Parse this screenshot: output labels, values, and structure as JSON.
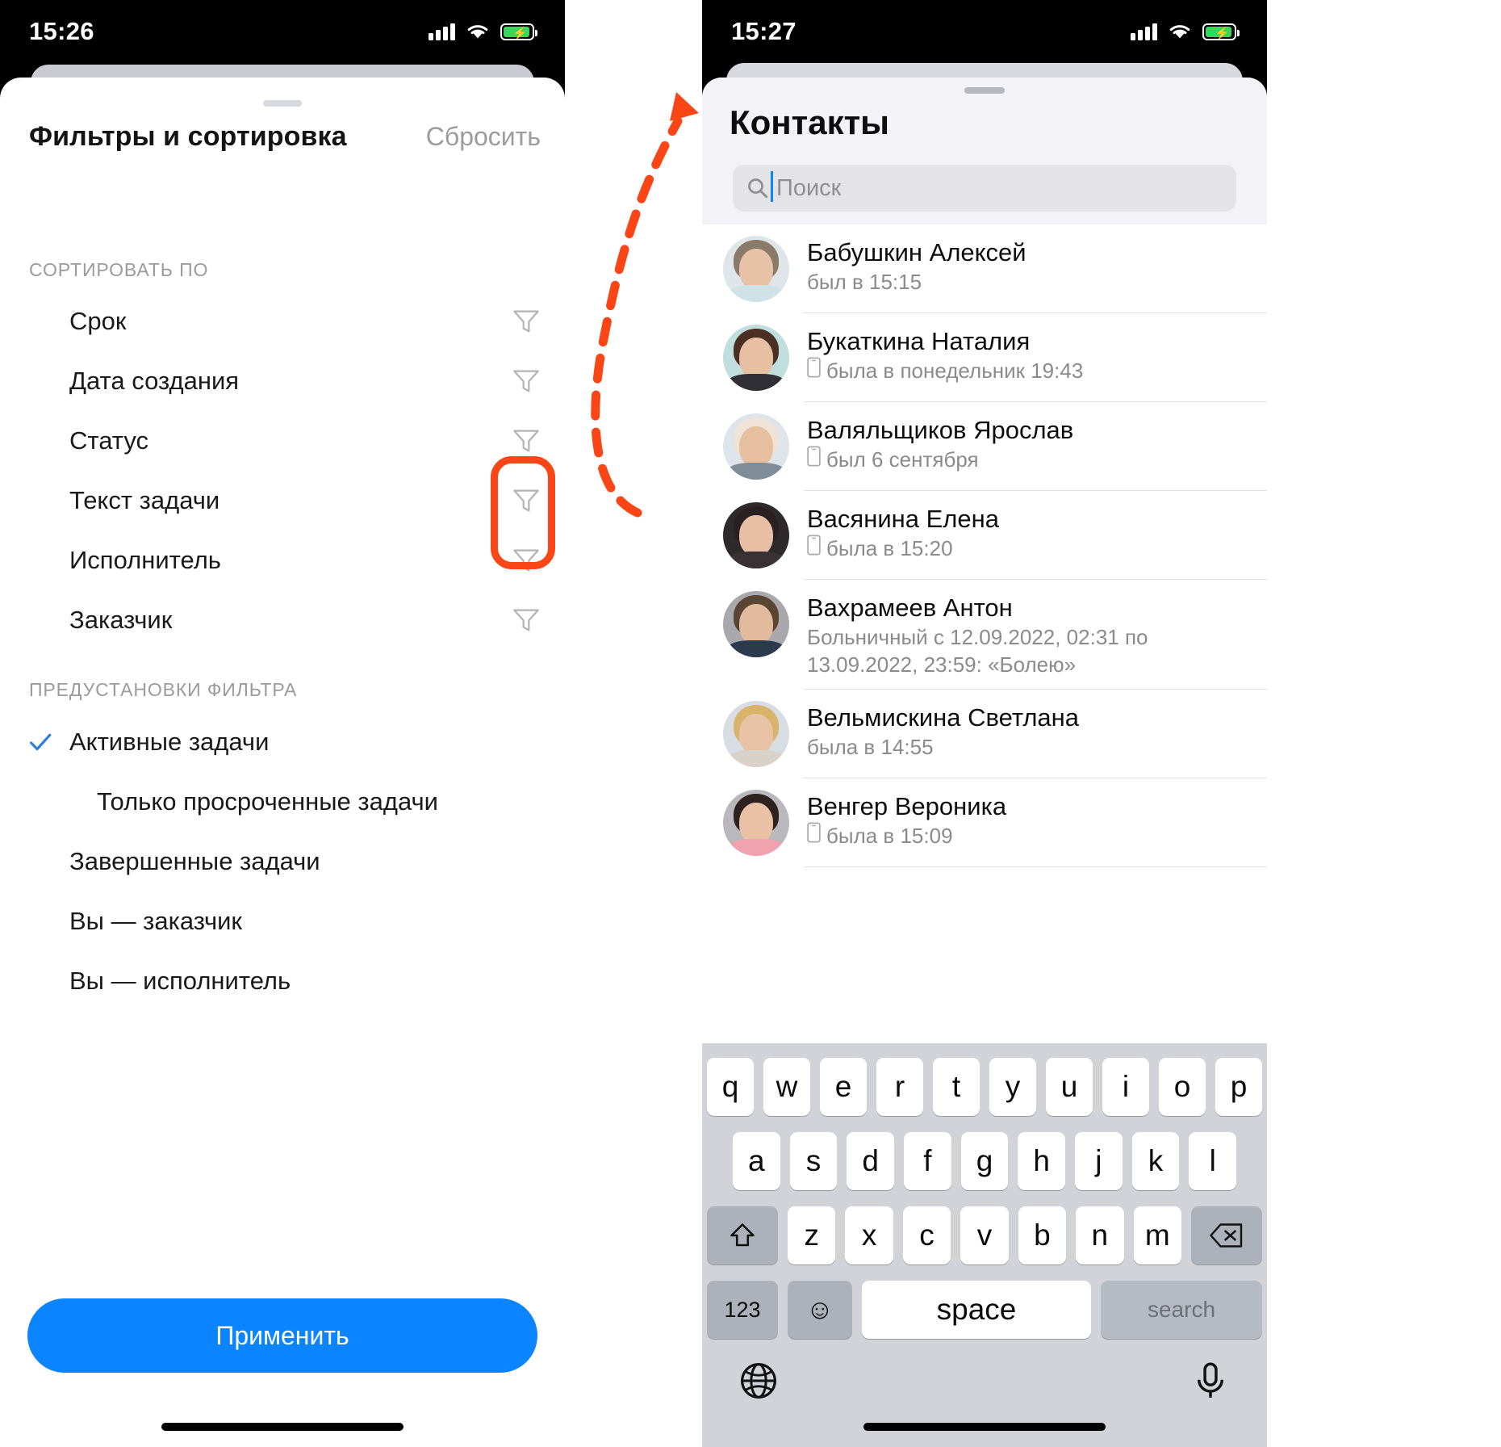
{
  "left_phone": {
    "status_bar": {
      "time": "15:26",
      "signal_icon": "cellular-bars-icon",
      "wifi_icon": "wifi-icon",
      "battery_icon": "battery-charging-icon"
    },
    "sheet": {
      "title": "Фильтры и сортировка",
      "reset_label": "Сбросить",
      "sort_section_label": "СОРТИРОВАТЬ ПО",
      "sort_rows": [
        {
          "label": "Срок",
          "filter_icon": "funnel-icon"
        },
        {
          "label": "Дата создания",
          "filter_icon": "funnel-icon"
        },
        {
          "label": "Статус",
          "filter_icon": "funnel-icon"
        },
        {
          "label": "Текст задачи",
          "filter_icon": "funnel-icon"
        },
        {
          "label": "Исполнитель",
          "filter_icon": "funnel-icon"
        },
        {
          "label": "Заказчик",
          "filter_icon": "funnel-icon"
        }
      ],
      "presets_section_label": "ПРЕДУСТАНОВКИ ФИЛЬТРА",
      "preset_rows": [
        {
          "label": "Активные задачи",
          "checked": true,
          "indent": false
        },
        {
          "label": "Только просроченные задачи",
          "checked": false,
          "indent": true
        },
        {
          "label": "Завершенные задачи",
          "checked": false,
          "indent": false
        },
        {
          "label": "Вы — заказчик",
          "checked": false,
          "indent": false
        },
        {
          "label": "Вы — исполнитель",
          "checked": false,
          "indent": false
        }
      ],
      "apply_label": "Применить"
    }
  },
  "right_phone": {
    "status_bar": {
      "time": "15:27",
      "signal_icon": "cellular-bars-icon",
      "wifi_icon": "wifi-icon",
      "battery_icon": "battery-charging-icon"
    },
    "contacts": {
      "title": "Контакты",
      "search_placeholder": "Поиск",
      "search_value": "",
      "search_icon": "search-icon",
      "items": [
        {
          "name": "Бабушкин Алексей",
          "status": "был в 15:15",
          "device_icon": ""
        },
        {
          "name": "Букаткина Наталия",
          "status": "была в понедельник 19:43",
          "device_icon": "phone-icon"
        },
        {
          "name": "Валяльщиков Ярослав",
          "status": "был 6 сентября",
          "device_icon": "phone-icon"
        },
        {
          "name": "Васянина Елена",
          "status": "была в 15:20",
          "device_icon": "phone-icon"
        },
        {
          "name": "Вахрамеев Антон",
          "status": "Больничный с 12.09.2022, 02:31 по 13.09.2022, 23:59: «Болею»",
          "device_icon": ""
        },
        {
          "name": "Вельмискина Светлана",
          "status": "была в 14:55",
          "device_icon": ""
        },
        {
          "name": "Венгер Вероника",
          "status": "была в 15:09",
          "device_icon": "phone-icon"
        }
      ]
    },
    "keyboard": {
      "row1": [
        "q",
        "w",
        "e",
        "r",
        "t",
        "y",
        "u",
        "i",
        "o",
        "p"
      ],
      "row2": [
        "a",
        "s",
        "d",
        "f",
        "g",
        "h",
        "j",
        "k",
        "l"
      ],
      "row3": [
        "z",
        "x",
        "c",
        "v",
        "b",
        "n",
        "m"
      ],
      "shift_icon": "shift-icon",
      "backspace_icon": "backspace-icon",
      "numbers_label": "123",
      "emoji_icon": "emoji-icon",
      "space_label": "space",
      "search_label": "search",
      "globe_icon": "globe-icon",
      "mic_icon": "microphone-icon"
    }
  },
  "annotations": {
    "highlight_color": "#fa4616",
    "arrow_icon": "curved-dashed-arrow-icon",
    "highlight_box_label": "filter-icons-highlight"
  }
}
